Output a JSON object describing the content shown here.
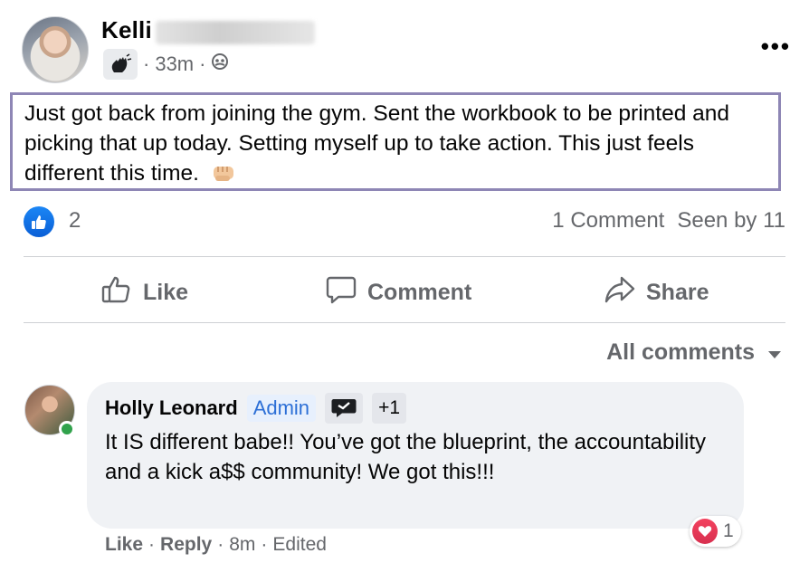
{
  "post": {
    "author_name": "Kelli",
    "timestamp": "33m",
    "separator": "·",
    "more_label": "•••",
    "body": "Just got back from joining the gym. Sent the workbook to be printed and picking that up today. Setting myself up to take action. This just feels different this time."
  },
  "stats": {
    "reaction_count": "2",
    "comments": "1 Comment",
    "seen_by": "Seen by 11"
  },
  "actions": {
    "like": "Like",
    "comment": "Comment",
    "share": "Share"
  },
  "comments_filter": {
    "label": "All comments"
  },
  "comment": {
    "author": "Holly Leonard",
    "admin_badge": "Admin",
    "extra_badges": "+1",
    "text": "It IS different babe!! You’ve got the blueprint, the accountability and a kick a$$ community! We got this!!!",
    "like": "Like",
    "reply": "Reply",
    "time": "8m",
    "edited": "Edited",
    "reaction_count": "1"
  },
  "colors": {
    "accent_blue": "#1877f2",
    "highlight_border": "#8e86b5",
    "muted_text": "#65676b",
    "heart_red": "#f3425f",
    "online_green": "#31a24c"
  },
  "icons": {
    "like_count": "thumbs-up-icon",
    "privacy": "group-icon",
    "badge": "waving-hand-icon",
    "body_emoji": "fist-icon",
    "comment_reaction": "heart-icon"
  }
}
